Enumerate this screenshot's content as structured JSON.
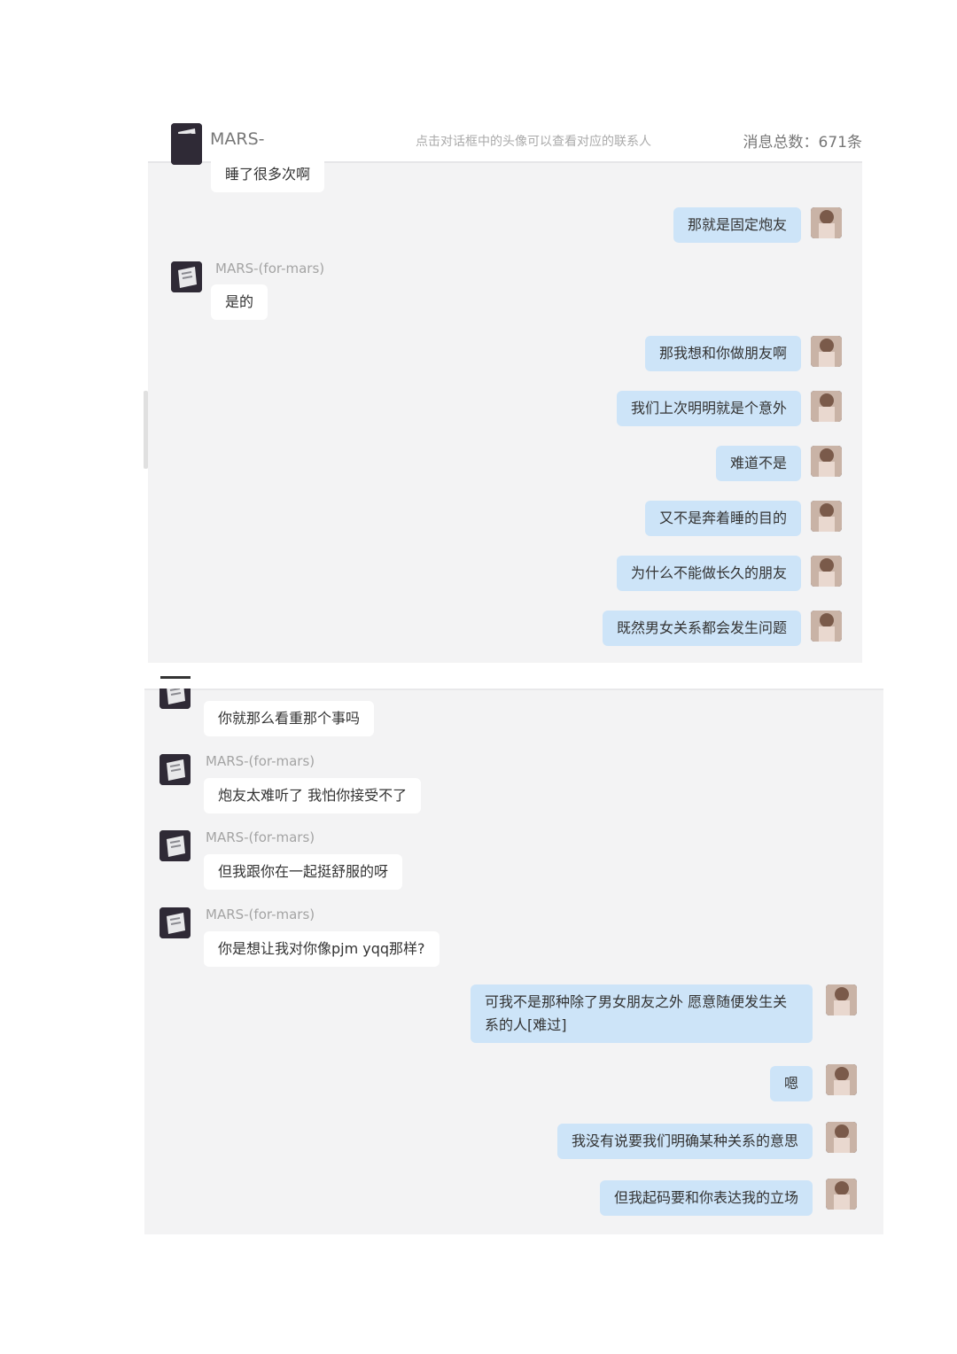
{
  "header": {
    "name": "MARS-",
    "hint": "点击对话框中的头像可以查看对应的联系人",
    "count": "消息总数：671条"
  },
  "panel1": {
    "msgs": [
      {
        "text": "睡了很多次啊"
      },
      {
        "text": "那就是固定炮友"
      },
      {
        "sender": "MARS-(for-mars)",
        "text": "是的"
      },
      {
        "text": "那我想和你做朋友啊"
      },
      {
        "text": "我们上次明明就是个意外"
      },
      {
        "text": "难道不是"
      },
      {
        "text": "又不是奔着睡的目的"
      },
      {
        "text": "为什么不能做长久的朋友"
      },
      {
        "text": "既然男女关系都会发生问题"
      }
    ]
  },
  "panel2": {
    "msgs": [
      {
        "text": "你就那么看重那个事吗"
      },
      {
        "sender": "MARS-(for-mars)",
        "text": "炮友太难听了 我怕你接受不了"
      },
      {
        "sender": "MARS-(for-mars)",
        "text": "但我跟你在一起挺舒服的呀"
      },
      {
        "sender": "MARS-(for-mars)",
        "text": "你是想让我对你像pjm yqq那样?"
      },
      {
        "text": "可我不是那种除了男女朋友之外 愿意随便发生关系的人[难过]"
      },
      {
        "text": "嗯"
      },
      {
        "text": "我没有说要我们明确某种关系的意思"
      },
      {
        "text": "但我起码要和你表达我的立场"
      }
    ]
  }
}
